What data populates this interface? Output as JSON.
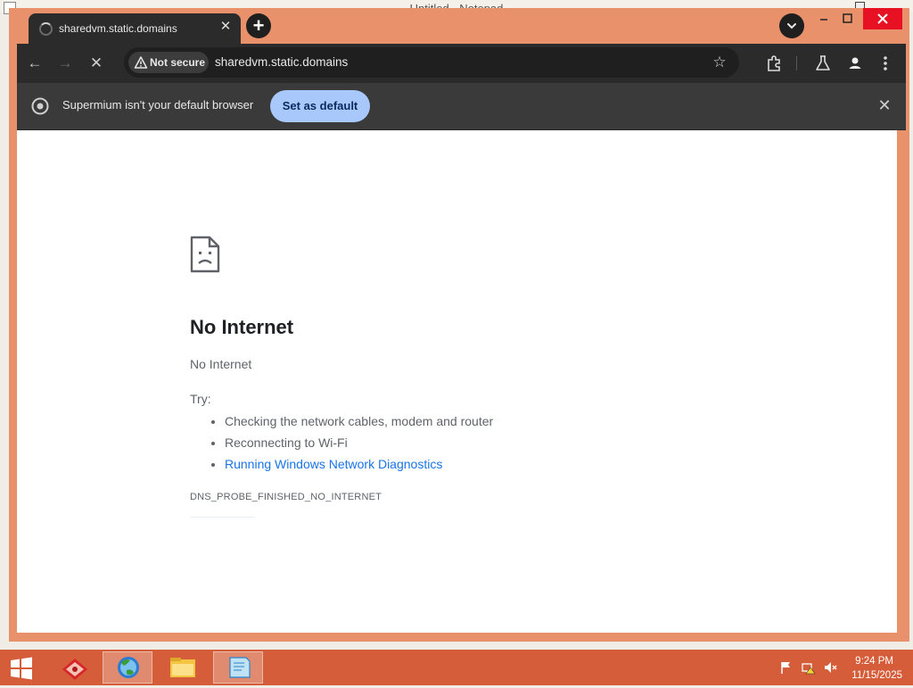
{
  "background_window": {
    "title": "Untitled - Notepad"
  },
  "browser": {
    "tab": {
      "title": "sharedvm.static.domains",
      "close_icon": "close-icon"
    },
    "new_tab_icon": "plus-icon",
    "toolbar": {
      "security_chip": "Not secure",
      "url": "sharedvm.static.domains"
    },
    "infobar": {
      "message": "Supermium isn't your default browser",
      "button": "Set as default"
    },
    "colors": {
      "frame": "#e8916a",
      "accent_button": "#a8c7fa",
      "link": "#1a73e8",
      "close_button": "#e81123"
    }
  },
  "error_page": {
    "title": "No Internet",
    "subtitle": "No Internet",
    "try_label": "Try:",
    "suggestions": [
      "Checking the network cables, modem and router",
      "Reconnecting to Wi-Fi",
      "Running Windows Network Diagnostics"
    ],
    "error_code": "DNS_PROBE_FINISHED_NO_INTERNET"
  },
  "taskbar": {
    "time": "9:24 PM",
    "date": "11/15/2025",
    "items": [
      "start-icon",
      "app-icon",
      "browser-icon",
      "file-explorer-icon",
      "notepad-icon"
    ],
    "color": "#d55d3a"
  }
}
